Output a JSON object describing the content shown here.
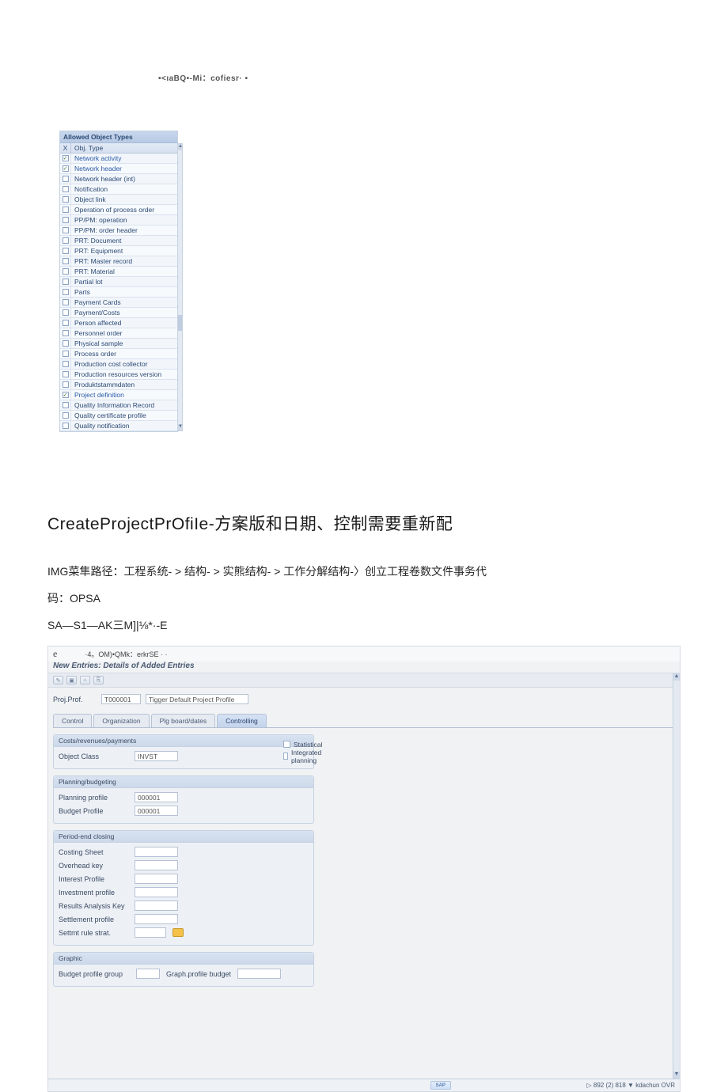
{
  "top_noise": "•<ıaBQ•-Mi：cofiesr· •",
  "panel1": {
    "header": "Allowed Object Types",
    "col_x": "X",
    "col_type": "Obj. Type",
    "rows": [
      {
        "label": "Network activity",
        "checked": true
      },
      {
        "label": "Network header",
        "checked": true
      },
      {
        "label": "Network header (int)",
        "checked": false
      },
      {
        "label": "Notification",
        "checked": false
      },
      {
        "label": "Object link",
        "checked": false
      },
      {
        "label": "Operation of process order",
        "checked": false
      },
      {
        "label": "PP/PM: operation",
        "checked": false
      },
      {
        "label": "PP/PM: order header",
        "checked": false
      },
      {
        "label": "PRT: Document",
        "checked": false
      },
      {
        "label": "PRT: Equipment",
        "checked": false
      },
      {
        "label": "PRT: Master record",
        "checked": false
      },
      {
        "label": "PRT: Material",
        "checked": false
      },
      {
        "label": "Partial lot",
        "checked": false
      },
      {
        "label": "Parts",
        "checked": false
      },
      {
        "label": "Payment Cards",
        "checked": false
      },
      {
        "label": "Payment/Costs",
        "checked": false
      },
      {
        "label": "Person affected",
        "checked": false
      },
      {
        "label": "Personnel order",
        "checked": false
      },
      {
        "label": "Physical sample",
        "checked": false
      },
      {
        "label": "Process order",
        "checked": false
      },
      {
        "label": "Production cost collector",
        "checked": false
      },
      {
        "label": "Production resources version",
        "checked": false
      },
      {
        "label": "Produktstammdaten",
        "checked": false
      },
      {
        "label": "Project definition",
        "checked": true
      },
      {
        "label": "Quality Information Record",
        "checked": false
      },
      {
        "label": "Quality certificate profile",
        "checked": false
      },
      {
        "label": "Quality notification",
        "checked": false
      }
    ]
  },
  "section_title": "CreateProjectPrOfiIe-方案版和日期、控制需要重新配",
  "path_line1": "IMG菜隼路径：工程系统- > 结构- > 实熊结构- > 工作分解结构-〉创立工程卷数文件事务代",
  "path_line2": "码：OPSA",
  "path_line3": "SA—S1—AK三M]|⅛*·-E",
  "panel2": {
    "title_fragment": "·4。OM)•QMk：erkrSE · ·",
    "subtitle": "New Entries: Details of Added Entries",
    "proj_prof_label": "Proj.Prof.",
    "proj_prof_value": "T000001",
    "proj_prof_desc": "Tigger Default Project Profile",
    "tabs": {
      "control": "Control",
      "organization": "Organization",
      "plg": "Plg board/dates",
      "controlling": "Controlling"
    },
    "group_costs": {
      "header": "Costs/revenues/payments",
      "object_class_label": "Object Class",
      "object_class_value": "INVST",
      "statistical": "Statistical",
      "integrated_planning": "Integrated planning"
    },
    "group_planning": {
      "header": "Planning/budgeting",
      "planning_profile_label": "Planning profile",
      "planning_profile_value": "000001",
      "budget_profile_label": "Budget Profile",
      "budget_profile_value": "000001"
    },
    "group_period": {
      "header": "Period-end closing",
      "costing_sheet": "Costing Sheet",
      "overhead_key": "Overhead key",
      "interest_profile": "Interest Profile",
      "investment_profile": "Investment profile",
      "results_analysis_key": "Results Analysis Key",
      "settlement_profile": "Settlement profile",
      "settmt_rule": "Settmt rule strat."
    },
    "group_graphic": {
      "header": "Graphic",
      "budget_profile_group": "Budget profile group",
      "graph_profile_budget": "Graph.profile budget"
    },
    "status_right": "▷  892 (2) 818 ▼   kdachun   OVR"
  }
}
